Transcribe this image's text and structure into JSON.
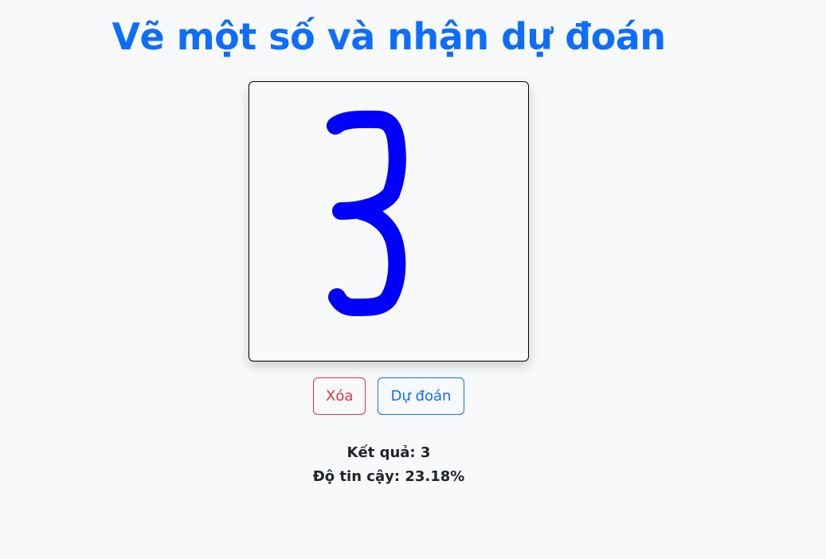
{
  "page": {
    "title": "Vẽ một số và nhận dự đoán"
  },
  "canvas": {
    "stroke_color": "#0000ff",
    "background": "#f8f9fa"
  },
  "buttons": {
    "clear_label": "Xóa",
    "predict_label": "Dự đoán"
  },
  "result": {
    "prediction_label": "Kết quả:",
    "prediction_value": "3",
    "confidence_label": "Độ tin cậy:",
    "confidence_value": "23.18%"
  }
}
